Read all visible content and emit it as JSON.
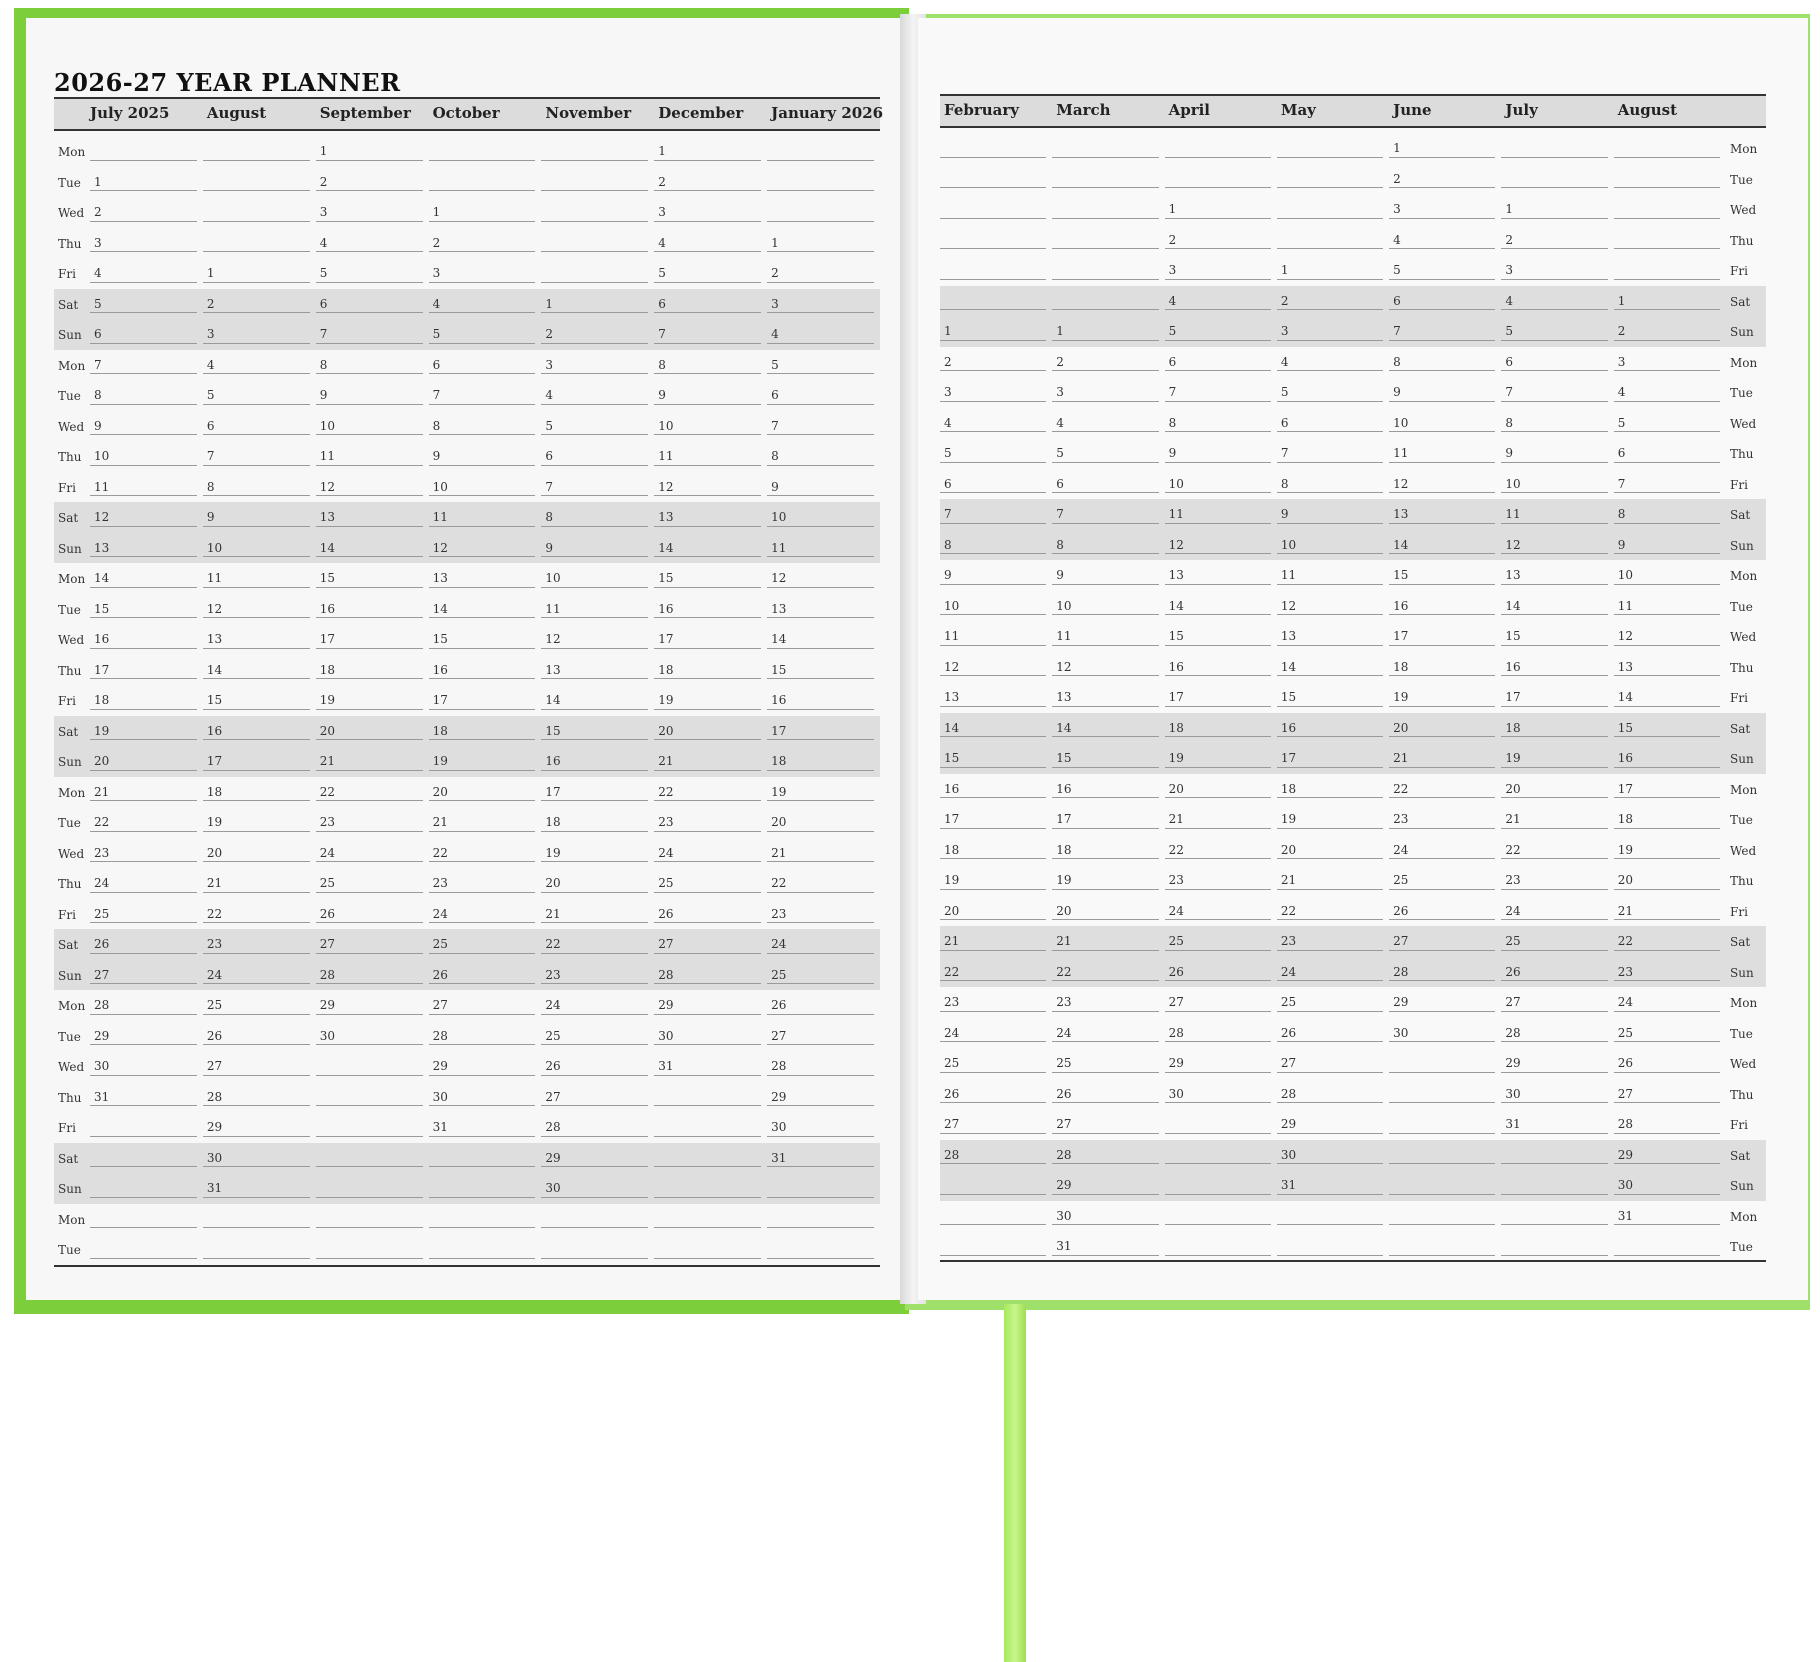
{
  "title": "2026-27 YEAR PLANNER",
  "left_months": [
    "July 2025",
    "August",
    "September",
    "October",
    "November",
    "December",
    "January 2026"
  ],
  "right_months": [
    "February",
    "March",
    "April",
    "May",
    "June",
    "July",
    "August"
  ],
  "days": [
    "Mon",
    "Tue",
    "Wed",
    "Thu",
    "Fri",
    "Sat",
    "Sun",
    "Mon",
    "Tue",
    "Wed",
    "Thu",
    "Fri",
    "Sat",
    "Sun",
    "Mon",
    "Tue",
    "Wed",
    "Thu",
    "Fri",
    "Sat",
    "Sun",
    "Mon",
    "Tue",
    "Wed",
    "Thu",
    "Fri",
    "Sat",
    "Sun",
    "Mon",
    "Tue",
    "Wed",
    "Thu",
    "Fri",
    "Sat",
    "Sun",
    "Mon",
    "Tue"
  ],
  "left_start_offsets": [
    1,
    4,
    0,
    2,
    5,
    0,
    3
  ],
  "left_month_lengths": [
    31,
    31,
    30,
    31,
    30,
    31,
    31
  ],
  "right_start_offsets": [
    6,
    6,
    2,
    4,
    0,
    2,
    5
  ],
  "right_month_lengths": [
    28,
    31,
    30,
    31,
    30,
    31,
    31
  ],
  "colors": {
    "cover": "#7ccf3a",
    "weekend_shade": "#dedede",
    "ribbon": "#b4ee70"
  }
}
